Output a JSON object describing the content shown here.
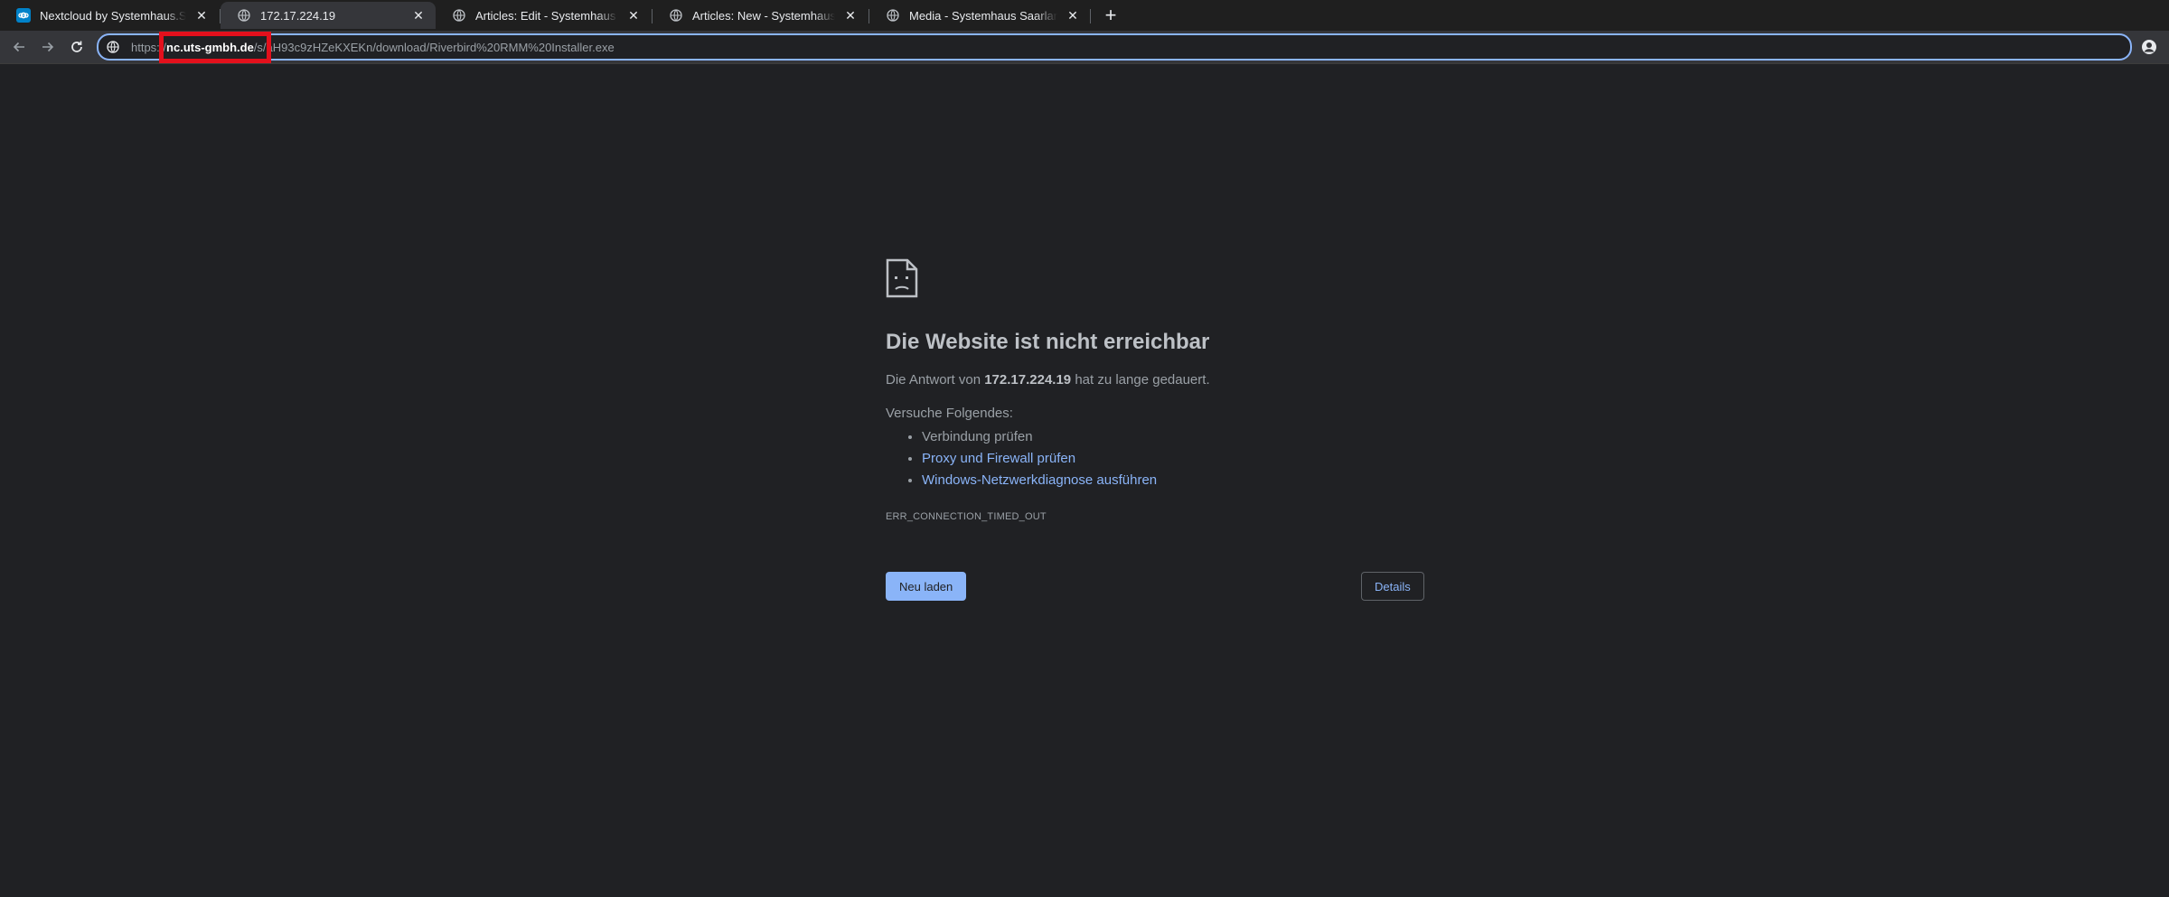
{
  "tabs": [
    {
      "title": "Nextcloud by Systemhaus.Saarland",
      "icon": "nextcloud-icon",
      "active": false
    },
    {
      "title": "172.17.224.19",
      "icon": "globe-icon",
      "active": true
    },
    {
      "title": "Articles: Edit - Systemhaus Saarland",
      "icon": "globe-icon",
      "active": false
    },
    {
      "title": "Articles: New - Systemhaus Saarland",
      "icon": "globe-icon",
      "active": false
    },
    {
      "title": "Media - Systemhaus Saarland | Dashboard",
      "icon": "globe-icon",
      "active": false
    }
  ],
  "tab_close_glyph": "✕",
  "new_tab_glyph": "+",
  "toolbar": {
    "url_scheme": "https://",
    "url_host": "nc.uts-gmbh.de",
    "url_rest": "/s/aH93c9zHZeKXEKn/download/Riverbird%20RMM%20Installer.exe"
  },
  "error": {
    "title": "Die Website ist nicht erreichbar",
    "message_prefix": "Die Antwort von ",
    "message_host": "172.17.224.19",
    "message_suffix": " hat zu lange gedauert.",
    "suggest_heading": "Versuche Folgendes:",
    "suggestions": [
      "Verbindung prüfen",
      "Proxy und Firewall prüfen",
      "Windows-Netzwerkdiagnose ausführen"
    ],
    "code": "ERR_CONNECTION_TIMED_OUT",
    "reload_label": "Neu laden",
    "details_label": "Details"
  },
  "colors": {
    "background": "#202124",
    "accent": "#8ab4f8",
    "highlight": "#e3101c"
  }
}
